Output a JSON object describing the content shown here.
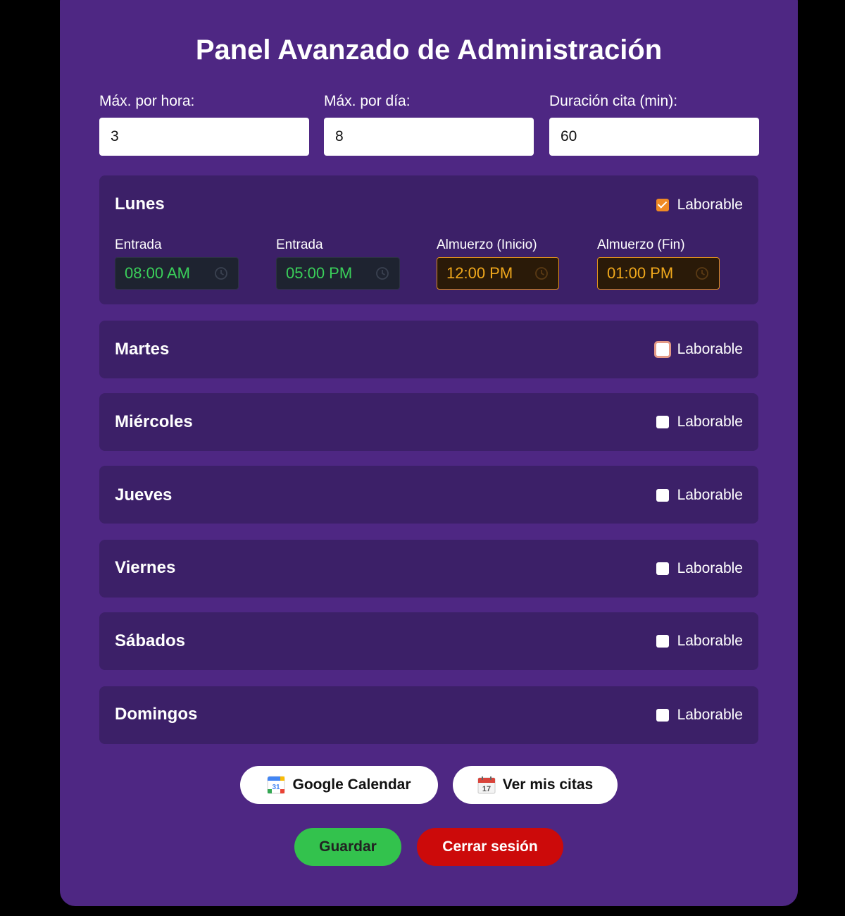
{
  "title": "Panel Avanzado de Administración",
  "limits": [
    {
      "label": "Máx. por hora:",
      "value": "3"
    },
    {
      "label": "Máx. por día:",
      "value": "8"
    },
    {
      "label": "Duración cita (min):",
      "value": "60"
    }
  ],
  "days": [
    {
      "name": "Lunes",
      "checkbox_label": "Laborable",
      "laborable": true,
      "times": [
        {
          "label": "Entrada",
          "value": "08:00 AM"
        },
        {
          "label": "Entrada",
          "value": "05:00 PM"
        },
        {
          "label": "Almuerzo (Inicio)",
          "value": "12:00 PM"
        },
        {
          "label": "Almuerzo (Fin)",
          "value": "01:00 PM"
        }
      ]
    },
    {
      "name": "Martes",
      "checkbox_label": "Laborable",
      "laborable": false
    },
    {
      "name": "Miércoles",
      "checkbox_label": "Laborable",
      "laborable": false
    },
    {
      "name": "Jueves",
      "checkbox_label": "Laborable",
      "laborable": false
    },
    {
      "name": "Viernes",
      "checkbox_label": "Laborable",
      "laborable": false
    },
    {
      "name": "Sábados",
      "checkbox_label": "Laborable",
      "laborable": false
    },
    {
      "name": "Domingos",
      "checkbox_label": "Laborable",
      "laborable": false
    }
  ],
  "buttons": {
    "google_calendar": "Google Calendar",
    "ver_citas": "Ver mis citas",
    "guardar": "Guardar",
    "cerrar_sesion": "Cerrar sesión"
  },
  "colors": {
    "panel_bg": "#4e2783",
    "card_bg": "#3c2068",
    "checkbox_checked": "#f08a24",
    "work_time_text": "#3ad05a",
    "lunch_time_text": "#f0a81c",
    "save_button": "#33c24d",
    "logout_button": "#cc0a0a"
  },
  "icons": {
    "google_calendar": "google-calendar-icon",
    "ver_citas": "calendar-17-icon",
    "time_input": "clock-icon"
  }
}
